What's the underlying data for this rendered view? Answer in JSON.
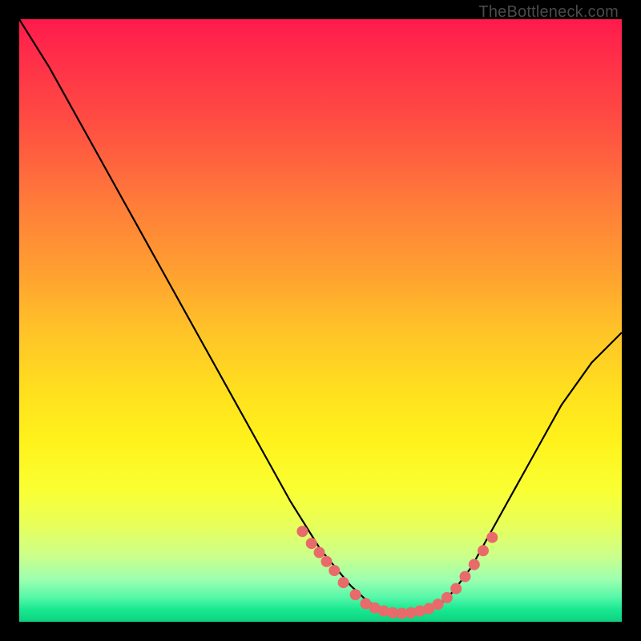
{
  "watermark": "TheBottleneck.com",
  "chart_data": {
    "type": "line",
    "title": "",
    "xlabel": "",
    "ylabel": "",
    "xlim": [
      0,
      100
    ],
    "ylim": [
      0,
      100
    ],
    "series": [
      {
        "name": "curve",
        "x": [
          0,
          5,
          10,
          15,
          20,
          25,
          30,
          35,
          40,
          45,
          50,
          55,
          58,
          60,
          62,
          64,
          66,
          68,
          70,
          72,
          75,
          80,
          85,
          90,
          95,
          100
        ],
        "y": [
          100,
          92,
          83,
          74,
          65,
          56,
          47,
          38,
          29,
          20,
          12,
          6,
          3.2,
          2.2,
          1.6,
          1.4,
          1.5,
          2.0,
          3.0,
          5,
          9,
          18,
          27,
          36,
          43,
          48
        ]
      }
    ],
    "markers": [
      {
        "name": "left-cluster",
        "points": [
          {
            "x": 47,
            "y": 15
          },
          {
            "x": 48.5,
            "y": 13
          },
          {
            "x": 49.8,
            "y": 11.5
          },
          {
            "x": 51,
            "y": 10
          },
          {
            "x": 52.3,
            "y": 8.5
          },
          {
            "x": 53.8,
            "y": 6.5
          },
          {
            "x": 55.8,
            "y": 4.5
          },
          {
            "x": 57.5,
            "y": 3.0
          }
        ]
      },
      {
        "name": "bottom-cluster",
        "points": [
          {
            "x": 59,
            "y": 2.3
          },
          {
            "x": 60.5,
            "y": 1.8
          },
          {
            "x": 62,
            "y": 1.5
          },
          {
            "x": 63.5,
            "y": 1.4
          },
          {
            "x": 65,
            "y": 1.5
          },
          {
            "x": 66.5,
            "y": 1.8
          },
          {
            "x": 68,
            "y": 2.2
          },
          {
            "x": 69.5,
            "y": 2.9
          }
        ]
      },
      {
        "name": "right-cluster",
        "points": [
          {
            "x": 71,
            "y": 4
          },
          {
            "x": 72.5,
            "y": 5.5
          },
          {
            "x": 74,
            "y": 7.5
          },
          {
            "x": 75.5,
            "y": 9.5
          },
          {
            "x": 77,
            "y": 11.8
          },
          {
            "x": 78.5,
            "y": 14
          }
        ]
      }
    ],
    "gradient_stops": [
      {
        "pos": 0,
        "color": "#ff1a4d"
      },
      {
        "pos": 100,
        "color": "#0ed080"
      }
    ]
  }
}
